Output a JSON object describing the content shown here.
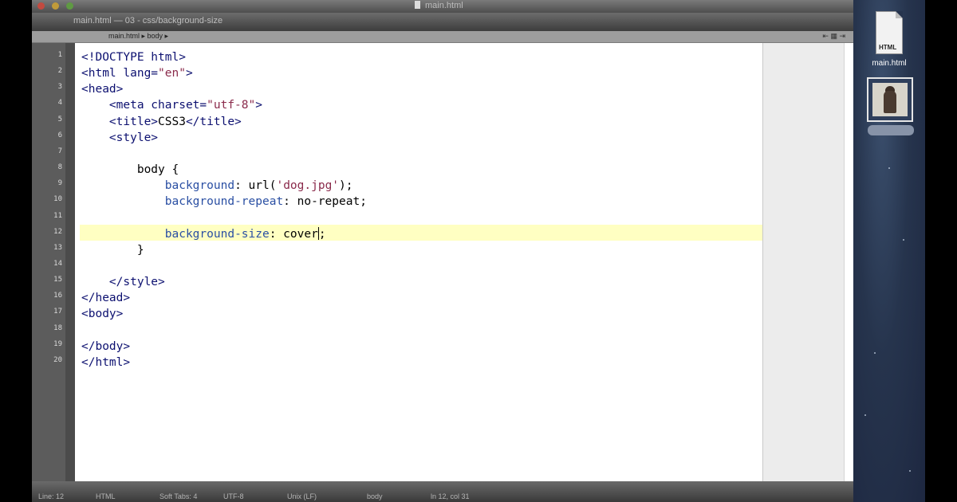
{
  "window": {
    "title": "main.html",
    "tab_text": "main.html — 03 - css/background-size",
    "path_bar": "main.html ▸ body ▸",
    "path_tools": "⇤ ▦ ⇥",
    "traffic_lights": [
      "close",
      "minimize",
      "zoom"
    ]
  },
  "colors": {
    "tag": "#0c1070",
    "property": "#2a4fa3",
    "string": "#8a2a4b",
    "current_line_highlight": "#ffffc2"
  },
  "editor": {
    "line_numbers": [
      "1",
      "2",
      "3",
      "4",
      "5",
      "6",
      "7",
      "8",
      "9",
      "10",
      "11",
      "12",
      "13",
      "14",
      "15",
      "16",
      "17",
      "18",
      "19",
      "20"
    ],
    "current_line": 12,
    "lines": [
      [
        {
          "t": "<!DOCTYPE html>",
          "c": "tag"
        }
      ],
      [
        {
          "t": "<html lang=",
          "c": "tag"
        },
        {
          "t": "\"en\"",
          "c": "string"
        },
        {
          "t": ">",
          "c": "tag"
        }
      ],
      [
        {
          "t": "<head>",
          "c": "tag"
        }
      ],
      [
        {
          "t": "    <meta charset=",
          "c": "tag"
        },
        {
          "t": "\"utf-8\"",
          "c": "string"
        },
        {
          "t": ">",
          "c": "tag"
        }
      ],
      [
        {
          "t": "    <title>",
          "c": "tag"
        },
        {
          "t": "CSS3",
          "c": "plain"
        },
        {
          "t": "</title>",
          "c": "tag"
        }
      ],
      [
        {
          "t": "    <style>",
          "c": "tag"
        }
      ],
      [],
      [
        {
          "t": "        body {",
          "c": "plain"
        }
      ],
      [
        {
          "t": "            ",
          "c": "plain"
        },
        {
          "t": "background",
          "c": "property"
        },
        {
          "t": ": url(",
          "c": "plain"
        },
        {
          "t": "'dog.jpg'",
          "c": "string"
        },
        {
          "t": ");",
          "c": "plain"
        }
      ],
      [
        {
          "t": "            ",
          "c": "plain"
        },
        {
          "t": "background-repeat",
          "c": "property"
        },
        {
          "t": ": no-repeat;",
          "c": "plain"
        }
      ],
      [],
      [
        {
          "t": "            ",
          "c": "plain"
        },
        {
          "t": "background-size",
          "c": "property"
        },
        {
          "t": ": cover",
          "c": "plain"
        },
        {
          "t": "",
          "c": "cursor"
        },
        {
          "t": ";",
          "c": "plain"
        }
      ],
      [
        {
          "t": "        }",
          "c": "plain"
        }
      ],
      [],
      [
        {
          "t": "    </style>",
          "c": "tag"
        }
      ],
      [
        {
          "t": "</head>",
          "c": "tag"
        }
      ],
      [
        {
          "t": "<body>",
          "c": "tag"
        }
      ],
      [],
      [
        {
          "t": "</body>",
          "c": "tag"
        }
      ],
      [
        {
          "t": "</html>",
          "c": "tag"
        }
      ]
    ]
  },
  "status_bar": {
    "segments": [
      "Line: 12",
      "HTML",
      "Soft Tabs: 4",
      "UTF-8",
      "Unix (LF)",
      "body",
      "ln 12, col 31"
    ]
  },
  "desktop": {
    "file_icon_label": "HTML",
    "file_name": "main.html",
    "image_file_icon": "dog-image-icon"
  }
}
